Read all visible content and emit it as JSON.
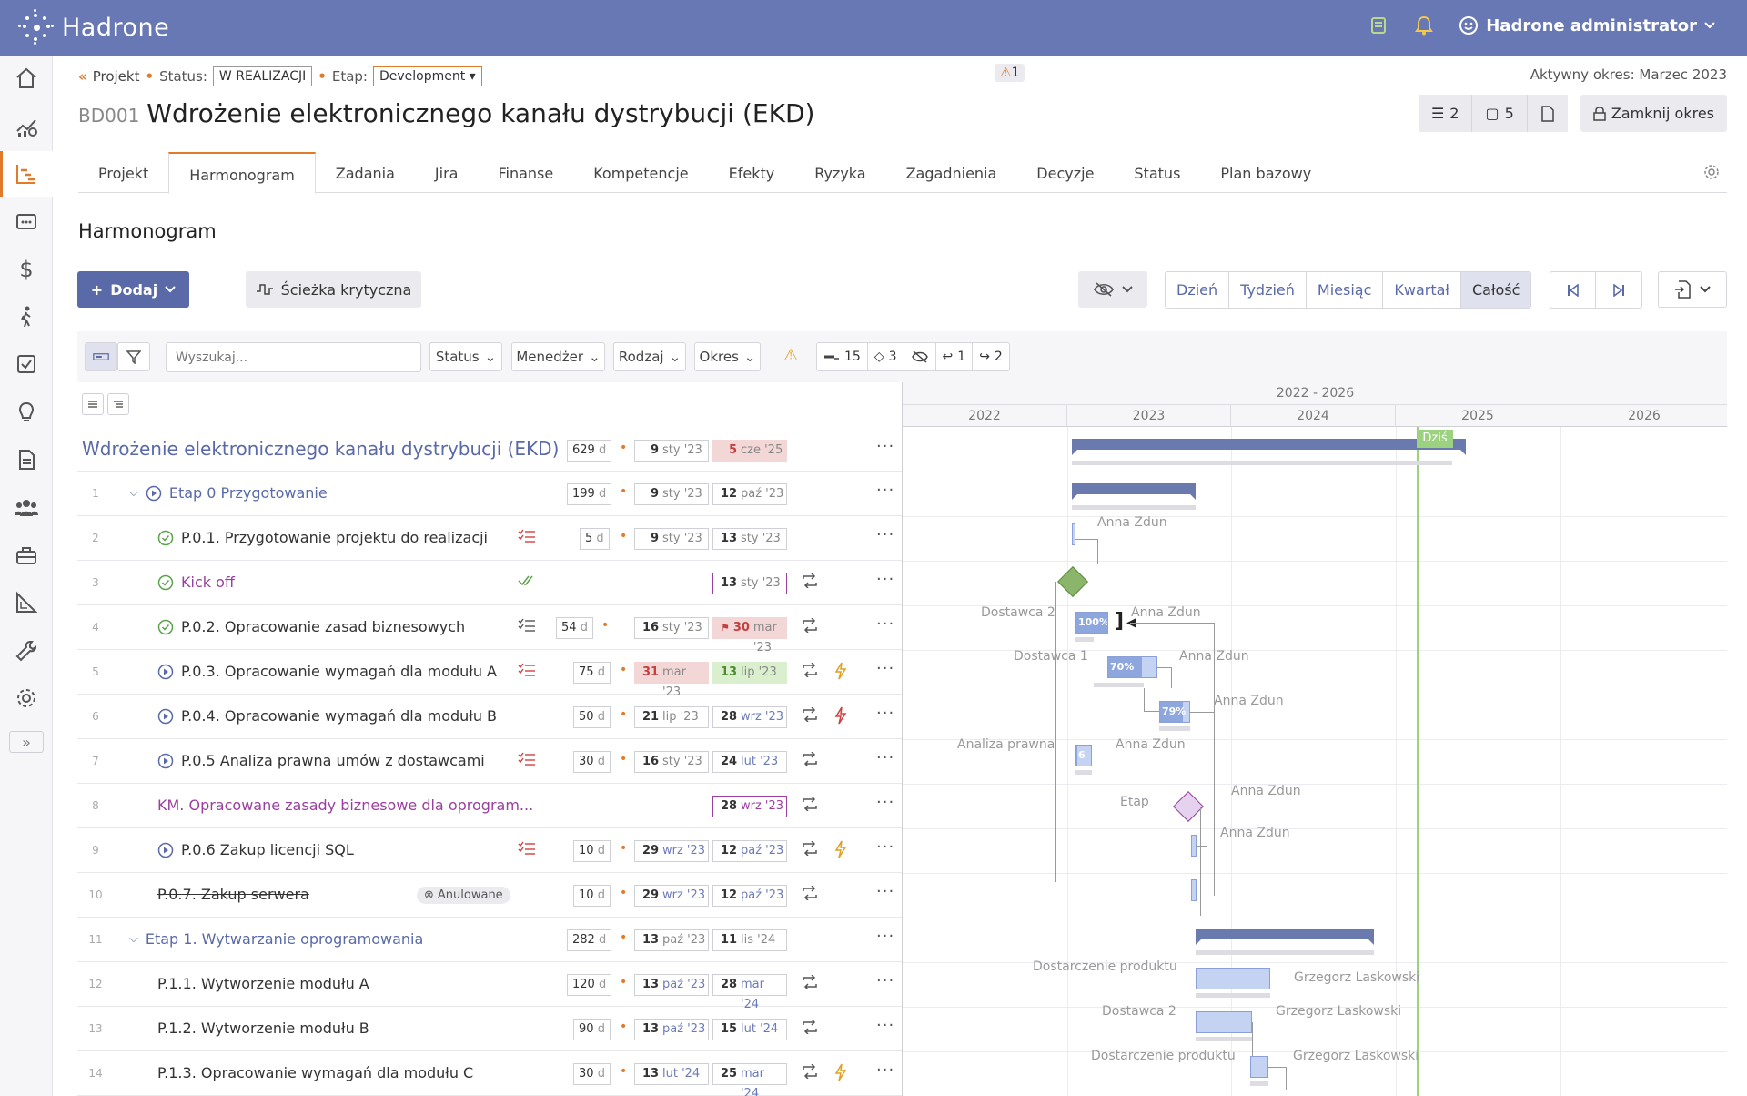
{
  "app": {
    "name": "Hadrone",
    "user": "Hadrone administrator"
  },
  "breadcrumb": {
    "project": "Projekt",
    "status_label": "Status:",
    "status_value": "W REALIZACJI",
    "stage_label": "Etap:",
    "stage_value": "Development"
  },
  "warning_count": "1",
  "active_period": "Aktywny okres: Marzec 2023",
  "project": {
    "code": "BD001",
    "title": "Wdrożenie elektronicznego kanału dystrybucji (EKD)"
  },
  "header_buttons": {
    "tasks_count": "2",
    "notes_count": "5",
    "close_period": "Zamknij okres"
  },
  "tabs": [
    {
      "label": "Projekt"
    },
    {
      "label": "Harmonogram"
    },
    {
      "label": "Zadania"
    },
    {
      "label": "Jira"
    },
    {
      "label": "Finanse"
    },
    {
      "label": "Kompetencje"
    },
    {
      "label": "Efekty"
    },
    {
      "label": "Ryzyka"
    },
    {
      "label": "Zagadnienia"
    },
    {
      "label": "Decyzje"
    },
    {
      "label": "Status"
    },
    {
      "label": "Plan bazowy"
    }
  ],
  "section_title": "Harmonogram",
  "toolbar": {
    "add": "Dodaj",
    "critical_path": "Ścieżka krytyczna",
    "zoom": [
      "Dzień",
      "Tydzień",
      "Miesiąc",
      "Kwartał",
      "Całość"
    ],
    "zoom_selected": "Całość"
  },
  "filters": {
    "search_placeholder": "Wyszukaj...",
    "status": "Status",
    "manager": "Menedżer",
    "type": "Rodzaj",
    "period": "Okres",
    "counts": {
      "tasks": "15",
      "milestones": "3",
      "hidden": "",
      "predecessors": "1",
      "successors": "2"
    }
  },
  "gantt": {
    "range": "2022 - 2026",
    "years": [
      "2022",
      "2023",
      "2024",
      "2025",
      "2026"
    ],
    "today": "Dziś"
  },
  "rows": [
    {
      "num": "",
      "name": "Wdrożenie elektronicznego kanału dystrybucji (EKD)",
      "dur": "629",
      "start_d": "9",
      "start_m": "sty '23",
      "end_d": "5",
      "end_m": "cze '25"
    },
    {
      "num": "1",
      "name": "Etap 0 Przygotowanie",
      "dur": "199",
      "start_d": "9",
      "start_m": "sty '23",
      "end_d": "12",
      "end_m": "paź '23"
    },
    {
      "num": "2",
      "name": "P.0.1. Przygotowanie projektu do realizacji",
      "dur": "5",
      "start_d": "9",
      "start_m": "sty '23",
      "end_d": "13",
      "end_m": "sty '23"
    },
    {
      "num": "3",
      "name": "Kick off",
      "dur": "",
      "start_d": "",
      "start_m": "",
      "end_d": "13",
      "end_m": "sty '23"
    },
    {
      "num": "4",
      "name": "P.0.2. Opracowanie zasad biznesowych",
      "dur": "54",
      "start_d": "16",
      "start_m": "sty '23",
      "end_d": "30",
      "end_m": "mar '23"
    },
    {
      "num": "5",
      "name": "P.0.3. Opracowanie wymagań dla modułu A",
      "dur": "75",
      "start_d": "31",
      "start_m": "mar '23",
      "end_d": "13",
      "end_m": "lip '23"
    },
    {
      "num": "6",
      "name": "P.0.4. Opracowanie wymagań dla modułu B",
      "dur": "50",
      "start_d": "21",
      "start_m": "lip '23",
      "end_d": "28",
      "end_m": "wrz '23"
    },
    {
      "num": "7",
      "name": "P.0.5 Analiza prawna umów z dostawcami",
      "dur": "30",
      "start_d": "16",
      "start_m": "sty '23",
      "end_d": "24",
      "end_m": "lut '23"
    },
    {
      "num": "8",
      "name": "KM. Opracowane zasady biznesowe dla oprogram...",
      "dur": "",
      "start_d": "",
      "start_m": "",
      "end_d": "28",
      "end_m": "wrz '23"
    },
    {
      "num": "9",
      "name": "P.0.6 Zakup licencji SQL",
      "dur": "10",
      "start_d": "29",
      "start_m": "wrz '23",
      "end_d": "12",
      "end_m": "paź '23"
    },
    {
      "num": "10",
      "name": "P.0.7. Zakup serwera",
      "badge": "Anulowane",
      "dur": "10",
      "start_d": "29",
      "start_m": "wrz '23",
      "end_d": "12",
      "end_m": "paź '23"
    },
    {
      "num": "11",
      "name": "Etap 1. Wytwarzanie oprogramowania",
      "dur": "282",
      "start_d": "13",
      "start_m": "paź '23",
      "end_d": "11",
      "end_m": "lis '24"
    },
    {
      "num": "12",
      "name": "P.1.1. Wytworzenie modułu A",
      "dur": "120",
      "start_d": "13",
      "start_m": "paź '23",
      "end_d": "28",
      "end_m": "mar '24"
    },
    {
      "num": "13",
      "name": "P.1.2. Wytworzenie modułu B",
      "dur": "90",
      "start_d": "13",
      "start_m": "paź '23",
      "end_d": "15",
      "end_m": "lut '24"
    },
    {
      "num": "14",
      "name": "P.1.3. Opracowanie wymagań dla modułu C",
      "dur": "30",
      "start_d": "13",
      "start_m": "lut '24",
      "end_d": "25",
      "end_m": "mar '24"
    }
  ],
  "dur_unit": "d",
  "gantt_labels": {
    "anna": "Anna Zdun",
    "grzegorz": "Grzegorz Laskowski",
    "dostawca2": "Dostawca 2",
    "dostawca1": "Dostawca 1",
    "analiza": "Analiza prawna",
    "etap": "Etap",
    "dostarczenie": "Dostarczenie produktu",
    "pct_100": "100%",
    "pct_70": "70%",
    "pct_79": "79%",
    "pct_6": "6"
  },
  "progress": {
    "task4": 1.0,
    "task5": 0.7,
    "task6": 0.79,
    "task7": 0.06
  },
  "colors": {
    "topbar": "#6878b4",
    "accent": "#e07b2c",
    "primary": "#5a6aa8",
    "milestone_done": "#8bb56a",
    "milestone_open": "#e4d2ee",
    "today": "#9bd17f"
  }
}
